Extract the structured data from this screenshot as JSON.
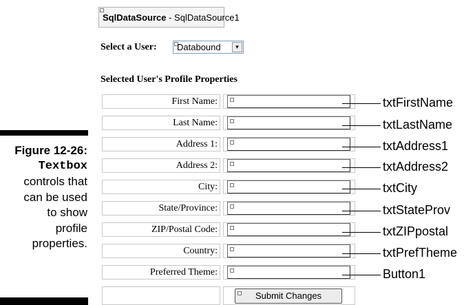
{
  "caption": {
    "figure": "Figure 12-26:",
    "code_word": "Textbox",
    "line1": "controls that",
    "line2": "can be used",
    "line3": "to show",
    "line4": "profile",
    "line5": "properties."
  },
  "datasource": {
    "type": "SqlDataSource",
    "separator": " - ",
    "id": "SqlDataSource1"
  },
  "user_select": {
    "label": "Select a User:",
    "value": "Databound",
    "arrow": "▾"
  },
  "section": {
    "title": "Selected User's Profile Properties"
  },
  "fields": [
    {
      "label": "First Name:",
      "callout": "txtFirstName"
    },
    {
      "label": "Last Name:",
      "callout": "txtLastName"
    },
    {
      "label": "Address 1:",
      "callout": "txtAddress1"
    },
    {
      "label": "Address 2:",
      "callout": "txtAddress2"
    },
    {
      "label": "City:",
      "callout": "txtCity"
    },
    {
      "label": "State/Province:",
      "callout": "txtStateProv"
    },
    {
      "label": "ZIP/Postal Code:",
      "callout": "txtZIPpostal"
    },
    {
      "label": "Country:",
      "callout": "txtPrefTheme"
    },
    {
      "label": "Preferred Theme:",
      "callout": "Button1"
    }
  ],
  "submit": {
    "label": "Submit Changes"
  }
}
